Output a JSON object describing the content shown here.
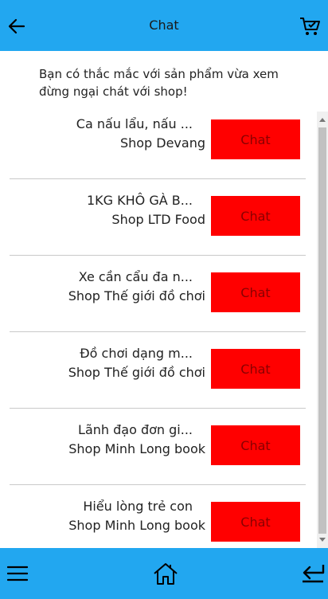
{
  "header": {
    "title": "Chat"
  },
  "intro": {
    "line1": "Bạn có thắc mắc với sản phẩm vừa xem",
    "line2": "đừng ngại chát với shop!"
  },
  "items": [
    {
      "product": "Ca nấu lẩu, nấu ...",
      "shop": "Shop Devang",
      "button": "Chat"
    },
    {
      "product": "1KG KHÔ GÀ B...",
      "shop": "Shop LTD Food",
      "button": "Chat"
    },
    {
      "product": "Xe cần cẩu đa n...",
      "shop": "Shop Thế giới đồ chơi",
      "button": "Chat"
    },
    {
      "product": "Đồ chơi dạng m...",
      "shop": "Shop Thế giới đồ chơi",
      "button": "Chat"
    },
    {
      "product": "Lãnh đạo đơn gi...",
      "shop": "Shop Minh Long book",
      "button": "Chat"
    },
    {
      "product": "Hiểu lòng trẻ con",
      "shop": "Shop Minh Long book",
      "button": "Chat"
    }
  ],
  "icons": {
    "back": "arrow-left-icon",
    "cart": "cart-icon",
    "menu": "menu-icon",
    "home": "home-icon",
    "return": "return-icon"
  },
  "colors": {
    "bar": "#22a7f0",
    "chat_button": "#ff0000",
    "chat_text": "#8a0000"
  }
}
